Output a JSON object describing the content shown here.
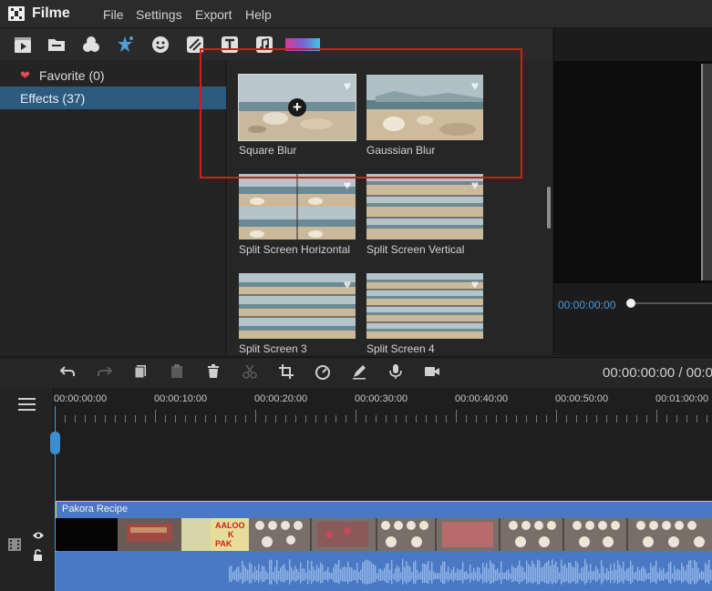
{
  "app": {
    "name": "Filme"
  },
  "menu": [
    "File",
    "Settings",
    "Export",
    "Help"
  ],
  "toolbar_icons": [
    "media-icon",
    "folder-icon",
    "filters-icon",
    "effects-icon",
    "sticker-icon",
    "transition-icon",
    "text-icon",
    "music-icon",
    "color-icon"
  ],
  "categories": {
    "favorite": "Favorite (0)",
    "effects": "Effects (37)"
  },
  "effects": [
    {
      "label": "Square Blur"
    },
    {
      "label": "Gaussian Blur"
    },
    {
      "label": "Split Screen Horizontal"
    },
    {
      "label": "Split Screen Vertical"
    },
    {
      "label": "Split Screen 3"
    },
    {
      "label": "Split Screen 4"
    }
  ],
  "preview": {
    "time": "00:00:00:00"
  },
  "edit_toolbar": [
    "undo-icon",
    "redo-icon",
    "copy-icon",
    "paste-icon",
    "delete-icon",
    "cut-icon",
    "crop-icon",
    "speed-icon",
    "pen-icon",
    "mic-icon",
    "camera-icon"
  ],
  "timecode": "00:00:00:00 / 00:0",
  "ruler": [
    "00:00:00:00",
    "00:00:10:00",
    "00:00:20:00",
    "00:00:30:00",
    "00:00:40:00",
    "00:00:50:00",
    "00:01:00:00"
  ],
  "clip": {
    "title": "Pakora Recipe",
    "frame_text": [
      "AALOO",
      "K",
      "PAK"
    ]
  },
  "colors": {
    "accent": "#2c5b80",
    "playhead": "#4aa0d8",
    "highlight": "#d01e1e",
    "clip": "#4a78c2"
  }
}
